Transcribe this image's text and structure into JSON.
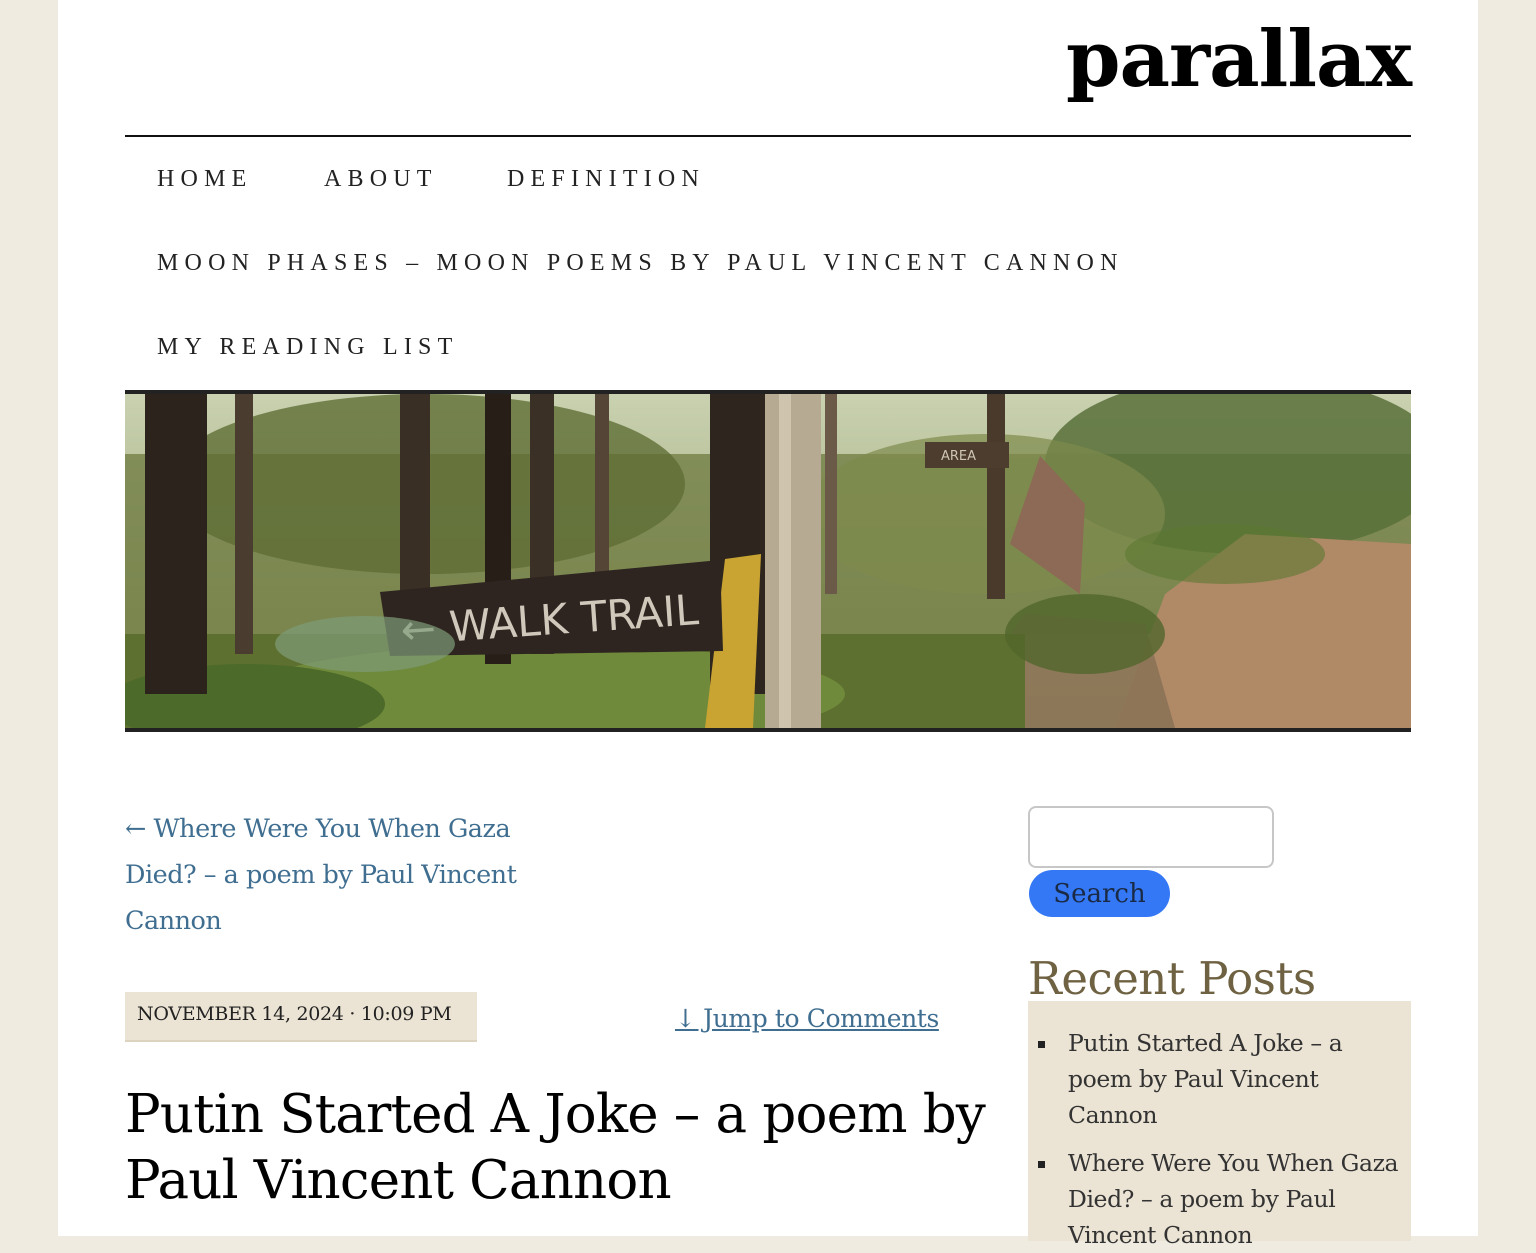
{
  "site": {
    "title": "parallax"
  },
  "nav": {
    "items": [
      {
        "label": "HOME"
      },
      {
        "label": "ABOUT"
      },
      {
        "label": "DEFINITION"
      },
      {
        "label": "MOON PHASES – MOON POEMS BY PAUL VINCENT CANNON"
      },
      {
        "label": "MY READING LIST"
      }
    ]
  },
  "banner": {
    "sign_text": "← WALK TRAIL",
    "area_sign": "AREA"
  },
  "post_nav": {
    "previous_label": "← Where Were You When Gaza Died? – a poem by Paul Vincent Cannon"
  },
  "post": {
    "date": "NOVEMBER 14, 2024 · 10:09 PM",
    "jump_label": "↓ Jump to Comments",
    "title": "Putin Started A Joke – a poem by Paul Vincent Cannon"
  },
  "sidebar": {
    "search": {
      "value": "",
      "button_label": "Search"
    },
    "recent": {
      "heading": "Recent Posts",
      "items": [
        {
          "label": "Putin Started A Joke – a poem by Paul Vincent Cannon"
        },
        {
          "label": "Where Were You When Gaza Died? – a poem by Paul Vincent Cannon"
        }
      ]
    }
  },
  "colors": {
    "link": "#3f6e90",
    "accent_button": "#3478f6",
    "sidebar_bg": "#ebe3d3",
    "heading_brown": "#6f6243",
    "page_bg": "#efebe1"
  },
  "icons": {
    "bullet": "square-bullet-icon"
  }
}
